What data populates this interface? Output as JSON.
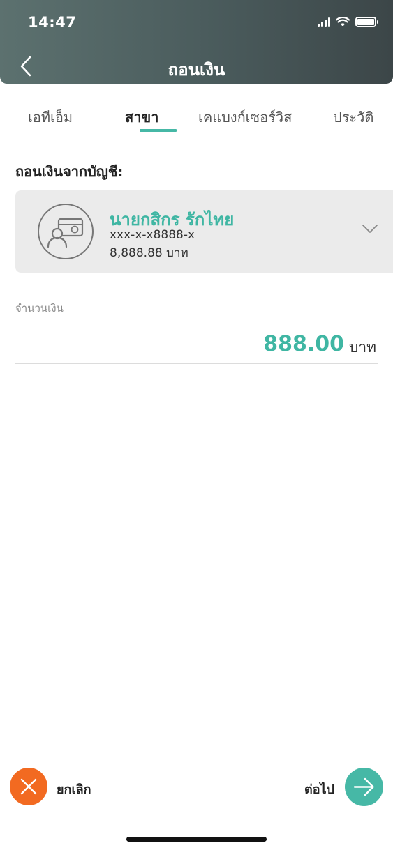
{
  "status_bar": {
    "time": "14:47"
  },
  "header": {
    "title": "ถอนเงิน"
  },
  "tabs": [
    {
      "label": "เอทีเอ็ม",
      "active": false
    },
    {
      "label": "สาขา",
      "active": true
    },
    {
      "label": "เคแบงก์เซอร์วิส",
      "active": false
    },
    {
      "label": "ประวัติ",
      "active": false
    }
  ],
  "withdraw_from": {
    "label": "ถอนเงินจากบัญชี:"
  },
  "account": {
    "name": "นายกสิกร รักไทย",
    "number": "xxx-x-x8888-x",
    "balance": "8,888.88 บาท"
  },
  "amount": {
    "label": "จำนวนเงิน",
    "value": "888.00",
    "unit": "บาท"
  },
  "footer": {
    "cancel_label": "ยกเลิก",
    "next_label": "ต่อไป"
  },
  "colors": {
    "accent": "#46b8a6",
    "cancel": "#f26a21",
    "header": "#4d5e5f"
  }
}
